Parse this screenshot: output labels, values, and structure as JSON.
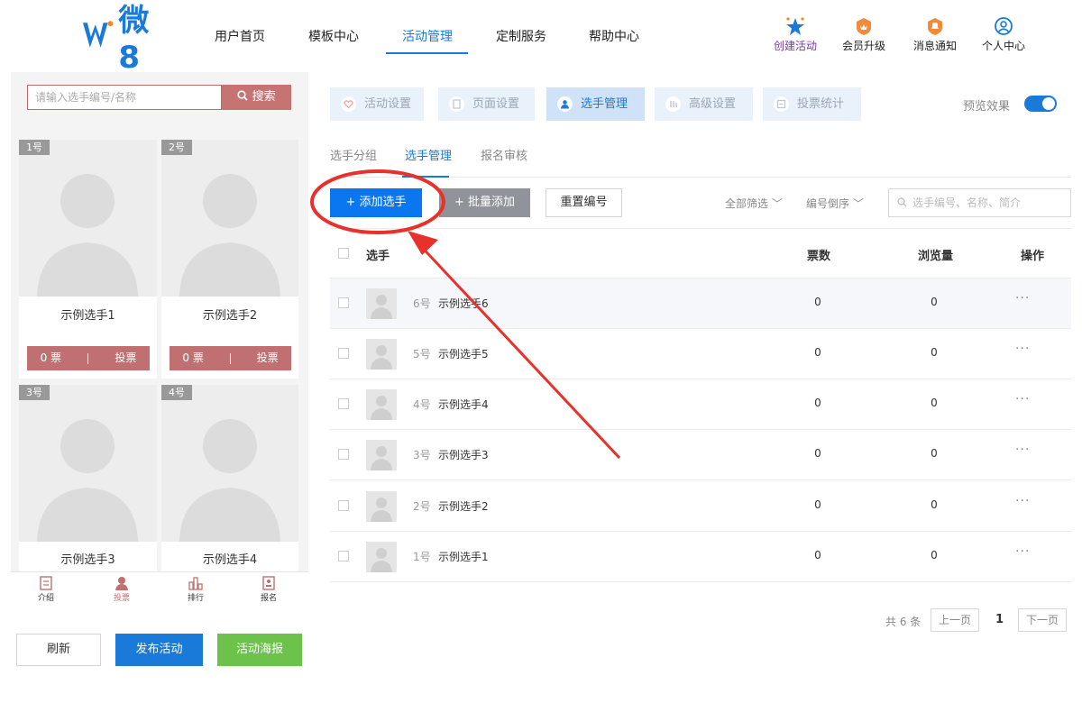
{
  "brand": {
    "logo_text": "微8",
    "accent": "#1a7ad9"
  },
  "nav": {
    "items": [
      {
        "label": "用户首页",
        "active": false
      },
      {
        "label": "模板中心",
        "active": false
      },
      {
        "label": "活动管理",
        "active": true
      },
      {
        "label": "定制服务",
        "active": false
      },
      {
        "label": "帮助中心",
        "active": false
      }
    ],
    "actions": [
      {
        "label": "创建活动",
        "icon": "stars-icon"
      },
      {
        "label": "会员升级",
        "icon": "crown-badge-icon"
      },
      {
        "label": "消息通知",
        "icon": "bell-badge-icon"
      },
      {
        "label": "个人中心",
        "icon": "user-circle-icon"
      }
    ]
  },
  "preview": {
    "search_placeholder": "请输入选手编号/名称",
    "search_button": "搜索",
    "cards": [
      {
        "num": "1号",
        "name": "示例选手1",
        "votes": "0 票",
        "vote_btn": "投票"
      },
      {
        "num": "2号",
        "name": "示例选手2",
        "votes": "0 票",
        "vote_btn": "投票"
      },
      {
        "num": "3号",
        "name": "示例选手3"
      },
      {
        "num": "4号",
        "name": "示例选手4"
      }
    ],
    "tabbar": [
      {
        "label": "介绍",
        "icon": "intro-icon",
        "active": false
      },
      {
        "label": "投票",
        "icon": "vote-user-icon",
        "active": true
      },
      {
        "label": "排行",
        "icon": "ranking-icon",
        "active": false
      },
      {
        "label": "报名",
        "icon": "signup-icon",
        "active": false
      }
    ],
    "buttons": {
      "refresh": "刷新",
      "publish": "发布活动",
      "poster": "活动海报"
    }
  },
  "steps": [
    {
      "label": "活动设置",
      "icon": "heart-icon",
      "active": false
    },
    {
      "label": "页面设置",
      "icon": "page-icon",
      "active": false
    },
    {
      "label": "选手管理",
      "icon": "user-icon",
      "active": true
    },
    {
      "label": "高级设置",
      "icon": "advanced-icon",
      "active": false
    },
    {
      "label": "投票统计",
      "icon": "stats-icon",
      "active": false
    }
  ],
  "preview_toggle": {
    "label": "预览效果",
    "on": true
  },
  "subtabs": [
    {
      "label": "选手分组",
      "active": false
    },
    {
      "label": "选手管理",
      "active": true
    },
    {
      "label": "报名审核",
      "active": false
    }
  ],
  "actions": {
    "add": "+ 添加选手",
    "batch": "+ 批量添加",
    "renumber": "重置编号",
    "filter_all": "全部筛选 ﹀",
    "sort": "编号倒序 ﹀",
    "search_placeholder": "选手编号、名称、简介"
  },
  "table": {
    "headers": {
      "player": "选手",
      "votes": "票数",
      "views": "浏览量",
      "ops": "操作"
    },
    "rows": [
      {
        "num": "6号",
        "name": "示例选手6",
        "votes": "0",
        "views": "0",
        "more": "···"
      },
      {
        "num": "5号",
        "name": "示例选手5",
        "votes": "0",
        "views": "0",
        "more": "···"
      },
      {
        "num": "4号",
        "name": "示例选手4",
        "votes": "0",
        "views": "0",
        "more": "···"
      },
      {
        "num": "3号",
        "name": "示例选手3",
        "votes": "0",
        "views": "0",
        "more": "···"
      },
      {
        "num": "2号",
        "name": "示例选手2",
        "votes": "0",
        "views": "0",
        "more": "···"
      },
      {
        "num": "1号",
        "name": "示例选手1",
        "votes": "0",
        "views": "0",
        "more": "···"
      }
    ]
  },
  "pager": {
    "total": "共 6 条",
    "prev": "上一页",
    "current": "1",
    "next": "下一页"
  }
}
